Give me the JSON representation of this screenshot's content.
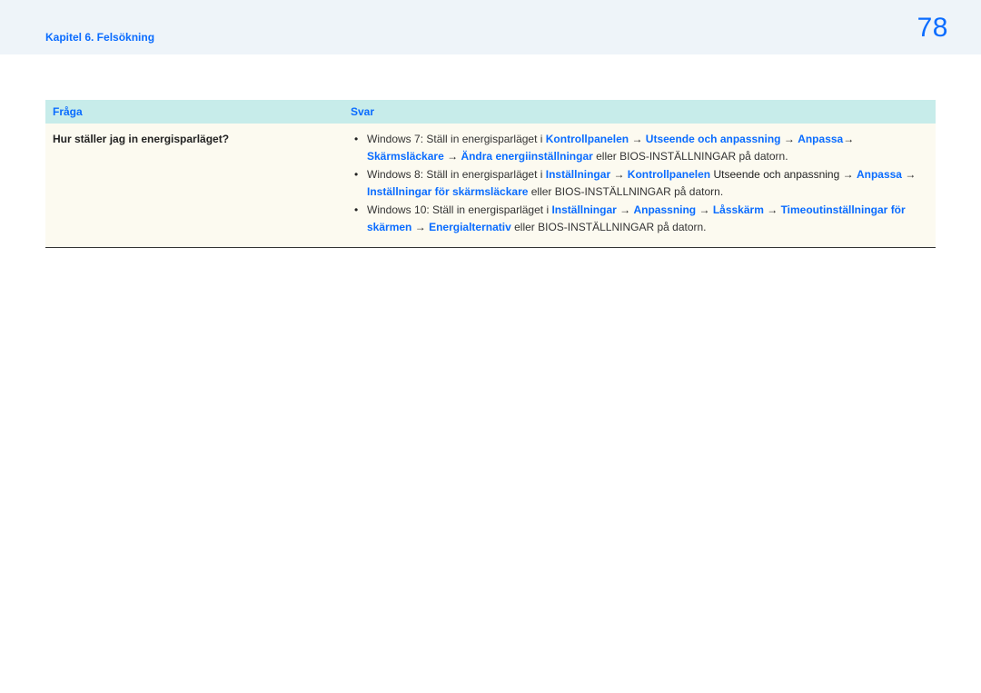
{
  "header": {
    "chapter": "Kapitel 6. Felsökning",
    "page": "78"
  },
  "table": {
    "headers": {
      "q": "Fråga",
      "a": "Svar"
    },
    "row": {
      "question": "Hur ställer jag in energisparläget?",
      "w7": {
        "prefix": "Windows 7: Ställ in energisparläget i ",
        "p1": "Kontrollpanelen",
        "p2": "Utseende och anpassning",
        "p3": "Anpassa",
        "p4": "Skärmsläckare",
        "p5": "Ändra energiinställningar",
        "suffix": " eller BIOS-INSTÄLLNINGAR på datorn."
      },
      "w8": {
        "prefix": "Windows 8: Ställ in energisparläget i ",
        "p1": "Inställningar",
        "p2": "Kontrollpanelen",
        "p3": "Utseende och anpassning",
        "p4": "Anpassa",
        "p5": "Inställningar för skärmsläckare",
        "suffix": " eller BIOS-INSTÄLLNINGAR på datorn."
      },
      "w10": {
        "prefix": "Windows 10: Ställ in energisparläget i ",
        "p1": "Inställningar",
        "p2": "Anpassning",
        "p3": "Låsskärm",
        "p4": "Timeoutinställningar för skärmen",
        "p5": "Energialternativ",
        "suffix": " eller BIOS-INSTÄLLNINGAR på datorn."
      },
      "arrow": "→"
    }
  }
}
